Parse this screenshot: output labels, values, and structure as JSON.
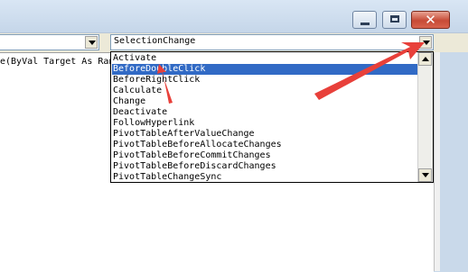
{
  "window": {
    "minimize_label": "",
    "maximize_label": "",
    "close_label": "✕"
  },
  "header": {
    "object_combo_value": "",
    "procedure_combo_value": "SelectionChange"
  },
  "code": {
    "line1": "e(ByVal Target As Ran"
  },
  "procedure_list": {
    "selected_index": 1,
    "items": [
      "Activate",
      "BeforeDoubleClick",
      "BeforeRightClick",
      "Calculate",
      "Change",
      "Deactivate",
      "FollowHyperlink",
      "PivotTableAfterValueChange",
      "PivotTableBeforeAllocateChanges",
      "PivotTableBeforeCommitChanges",
      "PivotTableBeforeDiscardChanges",
      "PivotTableChangeSync"
    ]
  },
  "colors": {
    "selection": "#316ac5",
    "annotation_arrow": "#e8403a"
  }
}
